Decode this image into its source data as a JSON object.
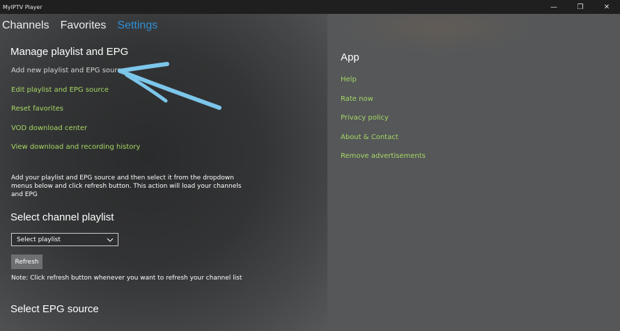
{
  "window": {
    "title": "MyIPTV Player",
    "controls": {
      "minimize": "—",
      "maximize": "❐",
      "close": "✕"
    }
  },
  "nav": {
    "tabs": [
      {
        "label": "Channels"
      },
      {
        "label": "Favorites"
      },
      {
        "label": "Settings",
        "active": true
      }
    ]
  },
  "manage": {
    "title": "Manage playlist and EPG",
    "links": [
      "Add new playlist and EPG source",
      "Edit playlist and EPG source",
      "Reset favorites",
      "VOD download center",
      "View download and recording history"
    ],
    "description": "Add your playlist and EPG source and then select it from the dropdown menus below and click refresh button. This action will load your channels and EPG"
  },
  "playlist": {
    "title": "Select channel playlist",
    "dropdown_value": "Select playlist",
    "refresh_label": "Refresh",
    "note": "Note: Click refresh button whenever you want to refresh your channel list"
  },
  "epg": {
    "title": "Select EPG source"
  },
  "app": {
    "title": "App",
    "links": [
      "Help",
      "Rate now",
      "Privacy policy",
      "About & Contact",
      "Remove advertisements"
    ]
  },
  "colors": {
    "accent_link": "#a6d864",
    "active_tab": "#2f8fd4",
    "annotation_arrow": "#7cc6ea"
  }
}
